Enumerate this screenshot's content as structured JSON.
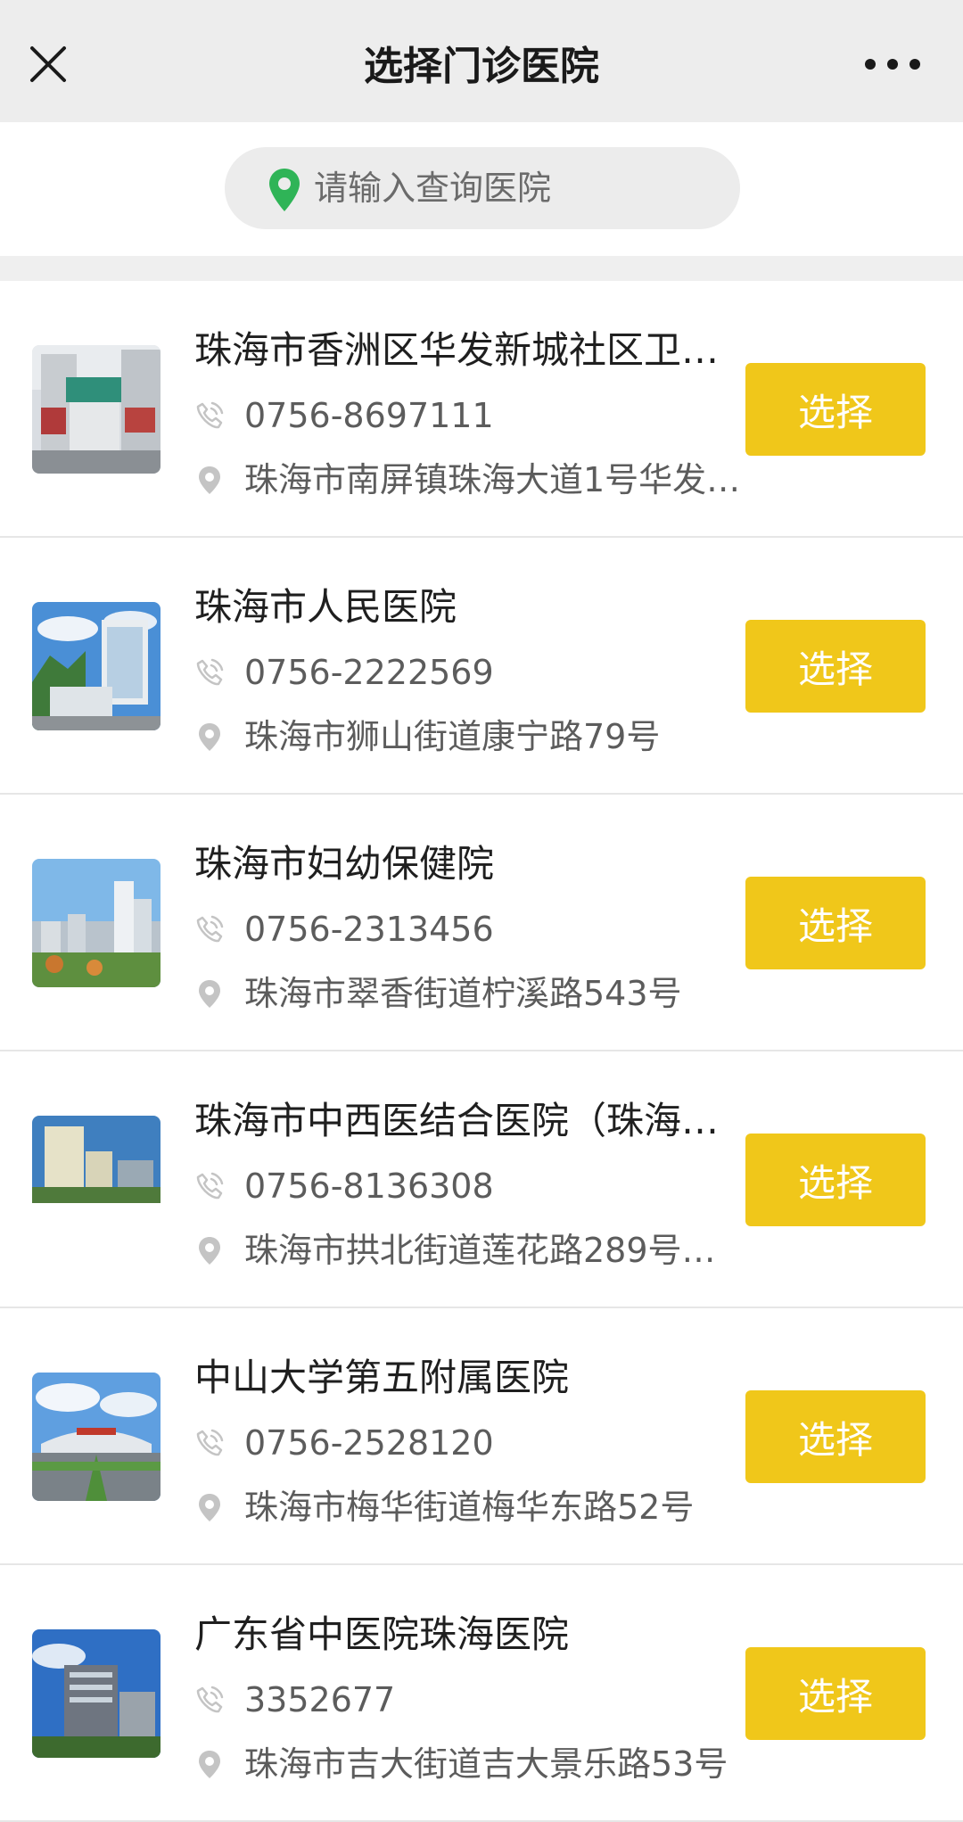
{
  "header": {
    "title": "选择门诊医院",
    "close_icon": "close-icon",
    "more_icon": "more-dots-icon"
  },
  "search": {
    "placeholder": "请输入查询医院",
    "value": "",
    "icon": "location-pin-icon",
    "icon_color": "#2fb457"
  },
  "colors": {
    "select_button": "#f0c71a",
    "header_bg": "#ededed"
  },
  "hospitals": [
    {
      "name": "珠海市香洲区华发新城社区卫…",
      "phone": "0756-8697111",
      "address": "珠海市南屏镇珠海大道1号华发…",
      "button": "选择"
    },
    {
      "name": "珠海市人民医院",
      "phone": "0756-2222569",
      "address": "珠海市狮山街道康宁路79号",
      "button": "选择"
    },
    {
      "name": "珠海市妇幼保健院",
      "phone": "0756-2313456",
      "address": "珠海市翠香街道柠溪路543号",
      "button": "选择"
    },
    {
      "name": "珠海市中西医结合医院（珠海…",
      "phone": "0756-8136308",
      "address": "珠海市拱北街道莲花路289号…",
      "button": "选择"
    },
    {
      "name": "中山大学第五附属医院",
      "phone": "0756-2528120",
      "address": "珠海市梅华街道梅华东路52号",
      "button": "选择"
    },
    {
      "name": "广东省中医院珠海医院",
      "phone": "3352677",
      "address": "珠海市吉大街道吉大景乐路53号",
      "button": "选择"
    }
  ]
}
